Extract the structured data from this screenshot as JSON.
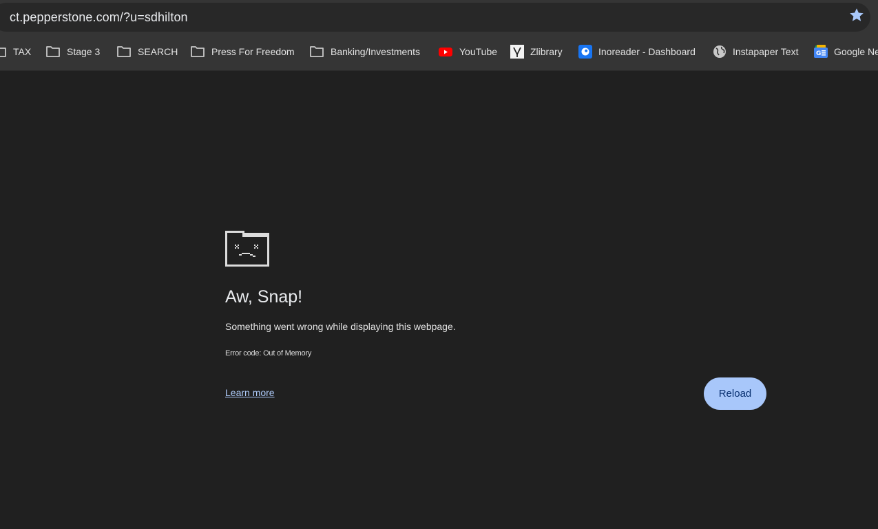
{
  "address_bar": {
    "url": "ct.pepperstone.com/?u=sdhilton",
    "bookmark_star_icon": "star-icon"
  },
  "bookmarks_bar": {
    "items": [
      {
        "label": "TAX",
        "icon": "folder-icon"
      },
      {
        "label": "Stage 3",
        "icon": "folder-icon"
      },
      {
        "label": "SEARCH",
        "icon": "folder-icon"
      },
      {
        "label": "Press For Freedom",
        "icon": "folder-icon"
      },
      {
        "label": "Banking/Investments",
        "icon": "folder-icon"
      },
      {
        "label": "YouTube",
        "icon": "youtube-icon"
      },
      {
        "label": "Zlibrary",
        "icon": "zlibrary-icon"
      },
      {
        "label": "Inoreader - Dashboard",
        "icon": "inoreader-icon"
      },
      {
        "label": "Instapaper Text",
        "icon": "globe-icon"
      },
      {
        "label": "Google Ne",
        "icon": "google-news-icon"
      }
    ]
  },
  "error_page": {
    "icon": "sad-folder-icon",
    "heading": "Aw, Snap!",
    "message": "Something went wrong while displaying this webpage.",
    "error_code": "Error code: Out of Memory",
    "learn_more_label": "Learn more",
    "reload_label": "Reload"
  },
  "colors": {
    "page_background": "#202020",
    "toolbar_background": "#353535",
    "reload_button": "#a8c7fa",
    "link": "#aecbfa"
  }
}
